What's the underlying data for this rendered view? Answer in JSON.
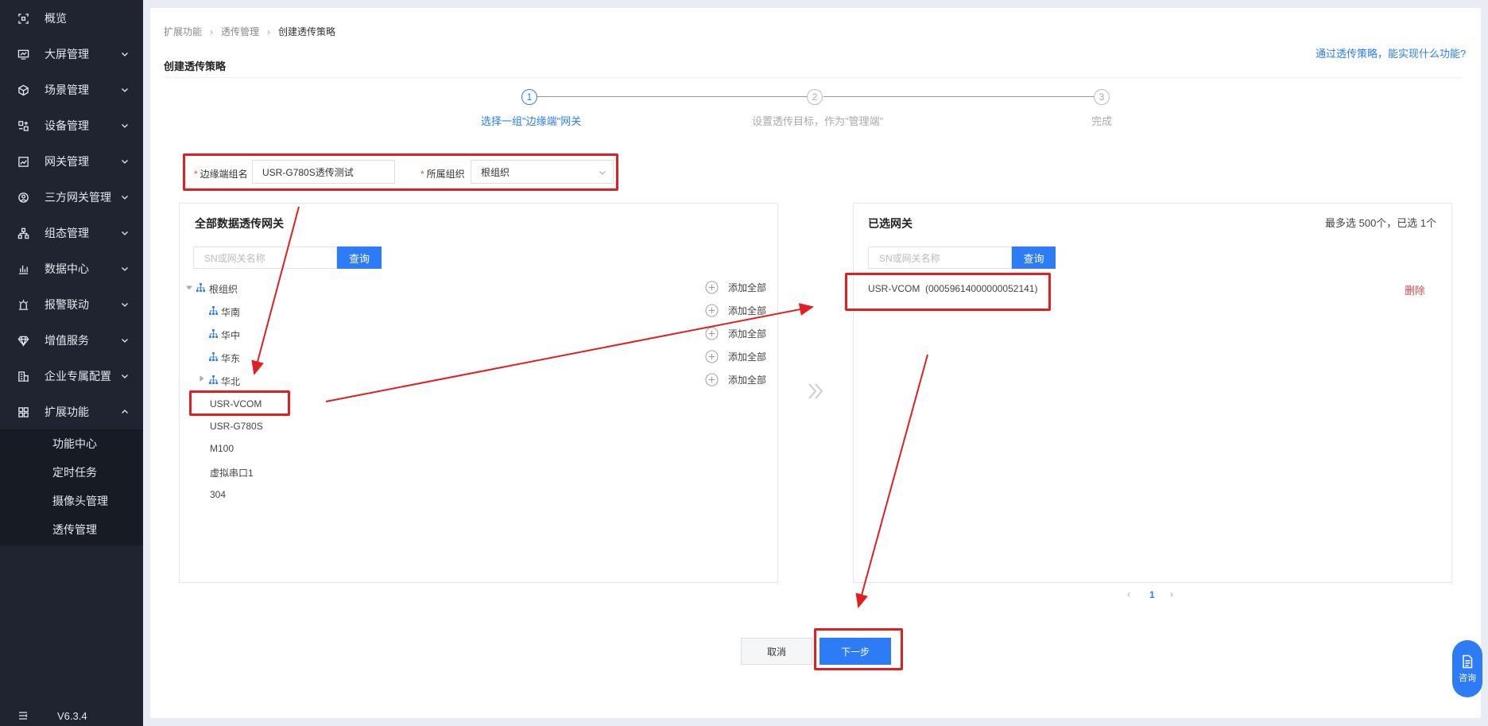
{
  "sidebar": {
    "items": [
      {
        "label": "概览",
        "icon": "scan-icon"
      },
      {
        "label": "大屏管理",
        "icon": "monitor-icon"
      },
      {
        "label": "场景管理",
        "icon": "cube-icon"
      },
      {
        "label": "设备管理",
        "icon": "device-grid-icon"
      },
      {
        "label": "网关管理",
        "icon": "chart-icon"
      },
      {
        "label": "三方网关管理",
        "icon": "people-icon"
      },
      {
        "label": "组态管理",
        "icon": "hierarchy-icon"
      },
      {
        "label": "数据中心",
        "icon": "bar-chart-icon"
      },
      {
        "label": "报警联动",
        "icon": "alarm-icon"
      },
      {
        "label": "增值服务",
        "icon": "diamond-icon"
      },
      {
        "label": "企业专属配置",
        "icon": "building-icon"
      },
      {
        "label": "扩展功能",
        "icon": "apps-icon"
      }
    ],
    "submenu": [
      "功能中心",
      "定时任务",
      "摄像头管理",
      "透传管理"
    ],
    "version": "V6.3.4"
  },
  "breadcrumb": [
    "扩展功能",
    "透传管理",
    "创建透传策略"
  ],
  "page_title": "创建透传策略",
  "help_link": "通过透传策略，能实现什么功能?",
  "steps": [
    {
      "num": "1",
      "label": "选择一组\"边缘端\"网关"
    },
    {
      "num": "2",
      "label": "设置透传目标，作为\"管理端\""
    },
    {
      "num": "3",
      "label": "完成"
    }
  ],
  "form": {
    "group_label": "边缘端组名",
    "group_value": "USR-G780S透传测试",
    "org_label": "所属组织",
    "org_value": "根组织"
  },
  "left_panel": {
    "title": "全部数据透传网关",
    "search_placeholder": "SN或网关名称",
    "search_button": "查询",
    "root": "根组织",
    "children": [
      "华南",
      "华中",
      "华东",
      "华北"
    ],
    "add_all_label": "添加全部",
    "gateways": [
      "USR-VCOM",
      "USR-G780S",
      "M100",
      "虚拟串口1",
      "304"
    ]
  },
  "right_panel": {
    "title": "已选网关",
    "limit_text": "最多选 500个，已选 1个",
    "search_placeholder": "SN或网关名称",
    "search_button": "查询",
    "selected": [
      {
        "name": "USR-VCOM  (00059614000000052141)",
        "delete": "删除"
      }
    ],
    "page": "1"
  },
  "buttons": {
    "cancel": "取消",
    "next": "下一步"
  },
  "consult": "咨询",
  "colors": {
    "accent": "#2d7cf6",
    "sidebar": "#1f2430",
    "annotation": "#e02020",
    "delete": "#e5484d"
  }
}
